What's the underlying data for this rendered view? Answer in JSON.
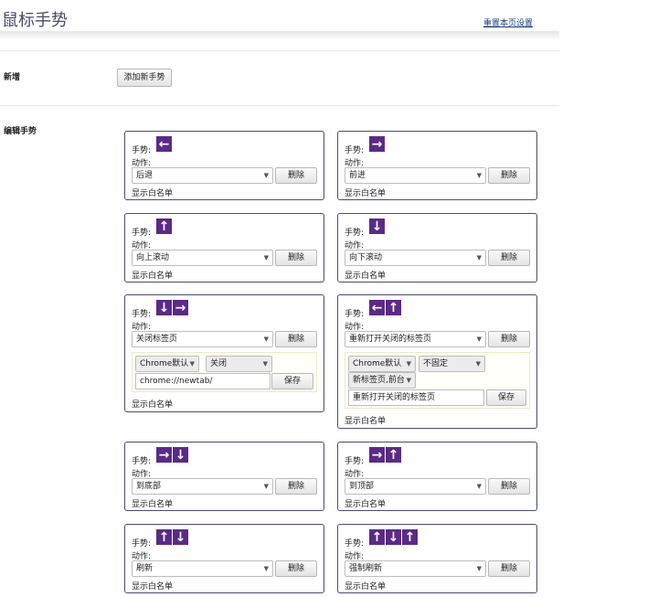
{
  "header": {
    "title": "鼠标手势",
    "reset_link": "重置本页设置"
  },
  "sections": {
    "add": "新增",
    "edit": "编辑手势"
  },
  "add_button": "添加新手势",
  "labels": {
    "gesture": "手势:",
    "action": "动作:",
    "whitelist": "显示白名单",
    "delete": "删除",
    "save": "保存"
  },
  "cards": [
    {
      "arrows": [
        "←"
      ],
      "action": "后退"
    },
    {
      "arrows": [
        "→"
      ],
      "action": "前进"
    },
    {
      "arrows": [
        "↑"
      ],
      "action": "向上滚动"
    },
    {
      "arrows": [
        "↓"
      ],
      "action": "向下滚动"
    },
    {
      "arrows": [
        "↓",
        "→"
      ],
      "action": "关闭标签页",
      "sub": {
        "sel1": "Chrome默认",
        "sel2": "关闭",
        "input": "chrome://newtab/"
      }
    },
    {
      "arrows": [
        "←",
        "↑"
      ],
      "action": "重新打开关闭的标签页",
      "sub": {
        "sel1": "Chrome默认",
        "sel2": "不固定",
        "sel3": "新标签页,前台",
        "input": "重新打开关闭的标签页"
      }
    },
    {
      "arrows": [
        "→",
        "↓"
      ],
      "action": "到底部"
    },
    {
      "arrows": [
        "→",
        "↑"
      ],
      "action": "到顶部"
    },
    {
      "arrows": [
        "↑",
        "↓"
      ],
      "action": "刷新"
    },
    {
      "arrows": [
        "↑",
        "↓",
        "↑"
      ],
      "action": "强制刷新"
    }
  ],
  "colors": {
    "arrow_bg": "#5b2a86",
    "card_border": "#4b4a7a",
    "link": "#1a3d7c"
  }
}
